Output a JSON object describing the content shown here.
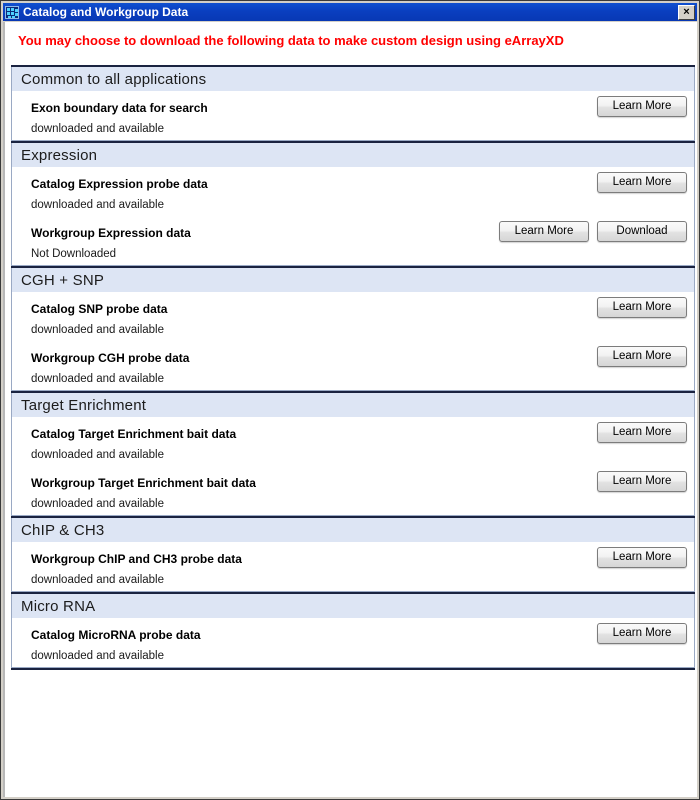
{
  "window": {
    "title": "Catalog and Workgroup Data",
    "icon": "microarray-icon",
    "close_label": "×"
  },
  "notice": "You may choose to download the following data to make custom design using eArrayXD",
  "labels": {
    "learn_more": "Learn More",
    "download": "Download"
  },
  "colors": {
    "titlebar": "#0a3fc0",
    "section_header_bg": "#dde5f4",
    "notice_text": "#ff0000",
    "panel_border": "#1a2340"
  },
  "sections": [
    {
      "title": "Common to all applications",
      "items": [
        {
          "title": "Exon boundary data for search",
          "status": "downloaded and available",
          "buttons": [
            "Learn More"
          ]
        }
      ]
    },
    {
      "title": "Expression",
      "items": [
        {
          "title": "Catalog Expression probe data",
          "status": "downloaded and available",
          "buttons": [
            "Learn More"
          ]
        },
        {
          "title": "Workgroup Expression data",
          "status": "Not Downloaded",
          "buttons": [
            "Learn More",
            "Download"
          ]
        }
      ]
    },
    {
      "title": "CGH + SNP",
      "items": [
        {
          "title": "Catalog SNP probe data",
          "status": "downloaded and available",
          "buttons": [
            "Learn More"
          ]
        },
        {
          "title": "Workgroup CGH probe data",
          "status": "downloaded and available",
          "buttons": [
            "Learn More"
          ]
        }
      ]
    },
    {
      "title": "Target Enrichment",
      "items": [
        {
          "title": "Catalog Target Enrichment bait data",
          "status": "downloaded and available",
          "buttons": [
            "Learn More"
          ]
        },
        {
          "title": "Workgroup Target Enrichment bait data",
          "status": "downloaded and available",
          "buttons": [
            "Learn More"
          ]
        }
      ]
    },
    {
      "title": "ChIP & CH3",
      "items": [
        {
          "title": "Workgroup ChIP and CH3 probe data",
          "status": "downloaded and available",
          "buttons": [
            "Learn More"
          ]
        }
      ]
    },
    {
      "title": "Micro RNA",
      "items": [
        {
          "title": "Catalog MicroRNA probe data",
          "status": "downloaded and available",
          "buttons": [
            "Learn More"
          ]
        }
      ]
    }
  ]
}
